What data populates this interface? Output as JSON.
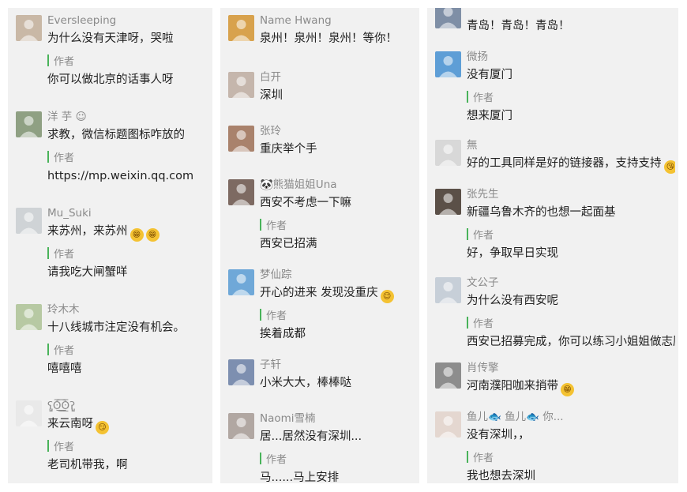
{
  "columns": [
    {
      "comments": [
        {
          "name": "Eversleeping",
          "text": "为什么没有天津呀，哭啦",
          "author_label": "作者",
          "reply": "你可以做北京的话事人呀",
          "avatar_color": "#c9b8a6",
          "avatar_icon": "person-avatar-icon"
        },
        {
          "name": "洋 芋 ☺",
          "text": "求教，微信标题图标咋放的",
          "author_label": "作者",
          "reply": "https://mp.weixin.qq.com",
          "avatar_color": "#8fa083",
          "avatar_icon": "person-avatar-icon"
        },
        {
          "name": "Mu_Suki",
          "text": "来苏州，来苏州",
          "emojis": [
            "😁",
            "😁"
          ],
          "author_label": "作者",
          "reply": "请我吃大闸蟹咩",
          "avatar_color": "#cfd3d6",
          "avatar_icon": "cartoon-avatar-icon"
        },
        {
          "name": "玲木木",
          "text": "十八线城市注定没有机会。",
          "author_label": "作者",
          "reply": "嘻嘻嘻",
          "avatar_color": "#b7c9a3",
          "avatar_icon": "cartoon-avatar-icon"
        },
        {
          "name": "ʕ̡̢̡ʘ̅͟͜͡ʘ̲̅ʔ̢̡̢",
          "text": "来云南呀",
          "emojis": [
            "😏"
          ],
          "author_label": "作者",
          "reply": "老司机带我，啊",
          "avatar_color": "#e9e9e9",
          "avatar_icon": "cartoon-avatar-icon"
        }
      ]
    },
    {
      "comments": [
        {
          "name": "Name Hwang",
          "text": "泉州！泉州！泉州！等你！",
          "avatar_color": "#d8a24d",
          "avatar_icon": "bear-avatar-icon"
        },
        {
          "name": "白开",
          "text": "深圳",
          "avatar_color": "#c5b6ac",
          "avatar_icon": "person-avatar-icon"
        },
        {
          "name": "张玲",
          "text": "重庆举个手",
          "avatar_color": "#a9826c",
          "avatar_icon": "person-avatar-icon"
        },
        {
          "name": "🐼熊猫姐姐Una",
          "text": "西安不考虑一下嘛",
          "author_label": "作者",
          "reply": "西安已招满",
          "avatar_color": "#7d6a62",
          "avatar_icon": "person-avatar-icon"
        },
        {
          "name": "梦仙踪",
          "text": "开心的进来 发现没重庆",
          "emojis": [
            "😉"
          ],
          "author_label": "作者",
          "reply": "挨着成都",
          "avatar_color": "#6fa8d8",
          "avatar_icon": "landscape-avatar-icon"
        },
        {
          "name": "子轩",
          "text": "小米大大，棒棒哒",
          "avatar_color": "#7d8fb0",
          "avatar_icon": "person-avatar-icon"
        },
        {
          "name": "Naomi雪楠",
          "text": "居...居然没有深圳...",
          "author_label": "作者",
          "reply": "马......马上安排",
          "avatar_color": "#b1a7a2",
          "avatar_icon": "person-avatar-icon"
        }
      ]
    },
    {
      "comments": [
        {
          "name": "",
          "text": "青岛！青岛！青岛！",
          "avatar_color": "#7f8fa6",
          "avatar_icon": "person-avatar-icon"
        },
        {
          "name": "微扬",
          "text": "没有厦门",
          "author_label": "作者",
          "reply": "想来厦门",
          "avatar_color": "#5e9ed6",
          "avatar_icon": "landscape-avatar-icon"
        },
        {
          "name": "無",
          "text": "好的工具同样是好的链接器，支持支持",
          "emojis": [
            "😘"
          ],
          "avatar_color": "#d8d8d8",
          "avatar_icon": "person-avatar-icon"
        },
        {
          "name": "张先生",
          "text": "新疆乌鲁木齐的也想一起面基",
          "author_label": "作者",
          "reply": "好，争取早日实现",
          "avatar_color": "#5b5048",
          "avatar_icon": "person-avatar-icon"
        },
        {
          "name": "文公子",
          "text": "为什么没有西安呢",
          "author_label": "作者",
          "reply": "西安已招募完成，你可以练习小姐姐做志愿",
          "avatar_color": "#c7cfd8",
          "avatar_icon": "person-avatar-icon"
        },
        {
          "name": "肖传擎",
          "text": "河南濮阳咖来捎带",
          "emojis": [
            "😁"
          ],
          "avatar_color": "#8d8d8d",
          "avatar_icon": "person-avatar-icon"
        },
        {
          "name": "鱼儿🐟 鱼儿🐟 你...",
          "text": "没有深圳，，",
          "author_label": "作者",
          "reply": "我也想去深圳",
          "avatar_color": "#e4d7d0",
          "avatar_icon": "person-avatar-icon"
        }
      ]
    }
  ],
  "colors": {
    "panel_bg": "#f1f1f1",
    "name": "#8a8a8a",
    "text": "#1f1f1f",
    "author_bar": "#49b35a"
  }
}
